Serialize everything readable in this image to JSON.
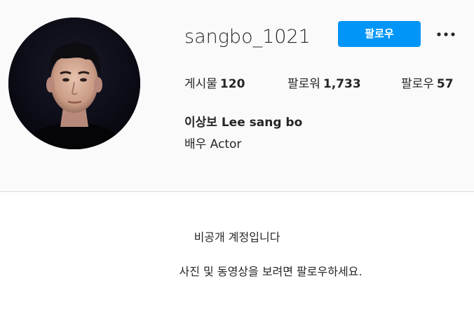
{
  "profile": {
    "username": "sangbo_1021",
    "follow_button_label": "팔로우",
    "more_options_icon": "ellipsis-icon",
    "accent_color": "#0095f6",
    "stats": {
      "posts_label": "게시물",
      "posts_count": "120",
      "followers_label": "팔로워",
      "followers_count": "1,733",
      "following_label": "팔로우",
      "following_count": "57"
    },
    "display_name": "이상보 Lee sang bo",
    "bio": "배우 Actor"
  },
  "private_notice": {
    "title": "비공개 계정입니다",
    "description": "사진 및 동영상을 보려면 팔로우하세요."
  }
}
